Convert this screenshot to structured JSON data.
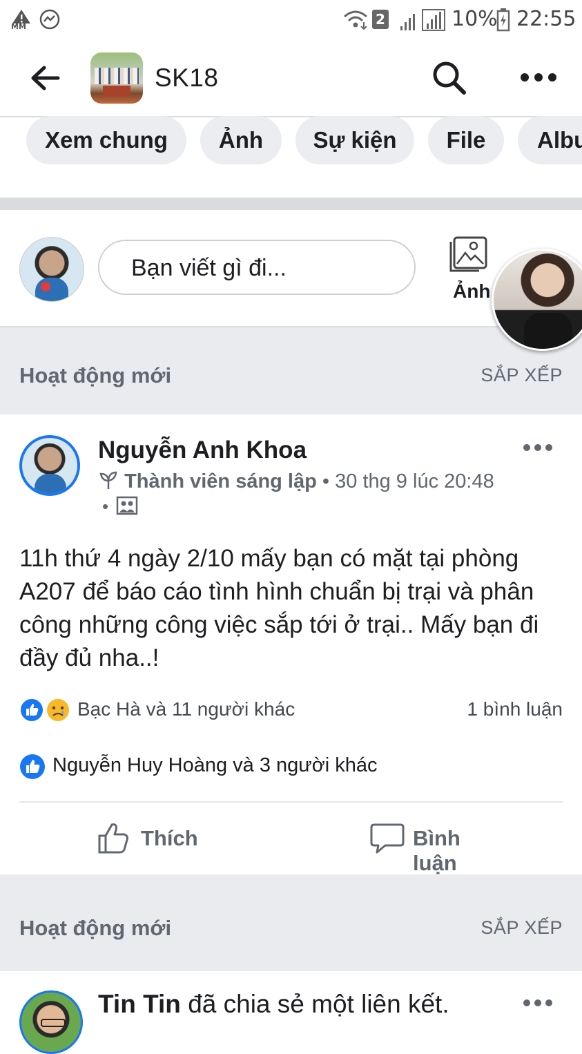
{
  "status_bar": {
    "battery": "10%",
    "time": "22:55",
    "sim_badge": "2",
    "left_icons": [
      "warning-icon",
      "messenger-icon"
    ],
    "mm_label": "MM"
  },
  "header": {
    "group_name": "SK18",
    "back_icon": "back-arrow-icon",
    "search_icon": "search-icon",
    "more_icon": "more-icon"
  },
  "tabs": [
    {
      "label": "Xem chung"
    },
    {
      "label": "Ảnh"
    },
    {
      "label": "Sự kiện"
    },
    {
      "label": "File"
    },
    {
      "label": "Albu"
    }
  ],
  "composer": {
    "placeholder": "Bạn viết gì đi...",
    "photo_label": "Ảnh"
  },
  "feed_section": {
    "title": "Hoạt động mới",
    "sort": "SẮP XẾP"
  },
  "post": {
    "author": "Nguyễn Anh Khoa",
    "role": "Thành viên sáng lập",
    "separator": "•",
    "timestamp": "30 thg 9 lúc 20:48",
    "body": "11h thứ 4 ngày 2/10 mấy bạn có mặt tại phòng A207 để báo cáo tình hình chuẩn bị trại và phân công những công việc sắp tới ở trại.. Mấy bạn đi đầy đủ nha..!",
    "reactions": "Bạc Hà và 11 người khác",
    "comments": "1 bình luận",
    "seen": "Nguyễn Huy Hoàng và 3 người khác",
    "like_label": "Thích",
    "comment_label": "Bình luận"
  },
  "feed_section_2": {
    "title": "Hoạt động mới",
    "sort": "SẮP XẾP"
  },
  "post2": {
    "author": "Tin Tin",
    "action": " đã chia sẻ một liên kết."
  },
  "colors": {
    "like_blue": "#1877f2",
    "sad_yellow": "#f7b928",
    "secondary_text": "#606770",
    "band_gray": "#e9ebee"
  }
}
